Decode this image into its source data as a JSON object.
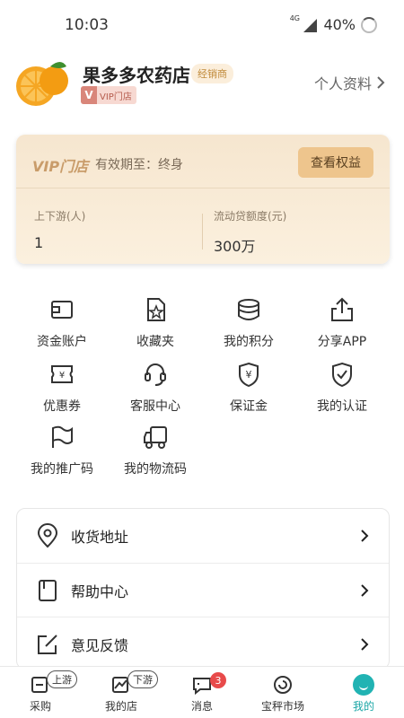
{
  "status_bar": {
    "time": "10:03",
    "network": "4G",
    "battery": "40%"
  },
  "profile": {
    "store_name": "果多多农药店",
    "role_badge": "经销商",
    "vip_tag": "VIP门店",
    "vip_tag_logo": "V",
    "profile_link": "个人资料"
  },
  "vip_card": {
    "title": "VIP门店",
    "validity": "有效期至：终身",
    "benefits_button": "查看权益",
    "stats": [
      {
        "label": "上下游(人)",
        "value": "1"
      },
      {
        "label": "流动贷额度(元)",
        "value": "300万"
      }
    ]
  },
  "grid": [
    {
      "label": "资金账户",
      "icon": "wallet-icon"
    },
    {
      "label": "收藏夹",
      "icon": "favorite-star-icon"
    },
    {
      "label": "我的积分",
      "icon": "coins-stack-icon"
    },
    {
      "label": "分享APP",
      "icon": "share-icon"
    },
    {
      "label": "优惠券",
      "icon": "coupon-icon"
    },
    {
      "label": "客服中心",
      "icon": "headset-icon"
    },
    {
      "label": "保证金",
      "icon": "deposit-shield-icon"
    },
    {
      "label": "我的认证",
      "icon": "certification-shield-icon"
    },
    {
      "label": "我的推广码",
      "icon": "flag-icon"
    },
    {
      "label": "我的物流码",
      "icon": "truck-icon"
    }
  ],
  "menu": [
    {
      "label": "收货地址",
      "icon": "location-pin-icon"
    },
    {
      "label": "帮助中心",
      "icon": "help-book-icon"
    },
    {
      "label": "意见反馈",
      "icon": "edit-feedback-icon"
    }
  ],
  "tabbar": [
    {
      "label": "采购",
      "pill": "上游",
      "icon": "purchase-icon"
    },
    {
      "label": "我的店",
      "pill": "下游",
      "icon": "store-chart-icon"
    },
    {
      "label": "消息",
      "badge": "3",
      "icon": "message-icon"
    },
    {
      "label": "宝秤市场",
      "icon": "market-icon"
    },
    {
      "label": "我的",
      "icon": "profile-smile-icon",
      "active": true
    }
  ],
  "colors": {
    "accent": "#21b3b3",
    "vip_gold": "#eec58d",
    "badge_red": "#e84a4a"
  }
}
